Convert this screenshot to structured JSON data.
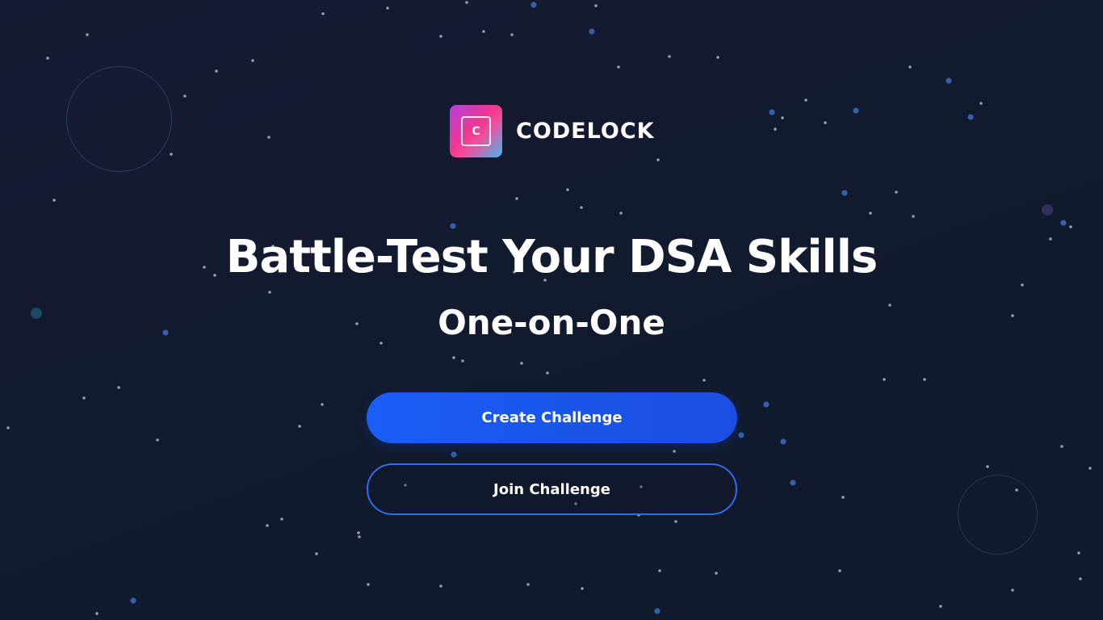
{
  "brand": {
    "logo_letter": "C",
    "name": "CODELOCK"
  },
  "hero": {
    "headline": "Battle-Test Your DSA Skills",
    "subheadline": "One-on-One"
  },
  "actions": {
    "create_label": "Create Challenge",
    "join_label": "Join Challenge"
  },
  "colors": {
    "background": "#131a2e",
    "primary_button": "#1a5ef5",
    "outline_button_border": "#2f6cf0",
    "logo_gradient_start": "#b13fe0",
    "logo_gradient_mid": "#f0378f",
    "logo_gradient_end": "#3fb8f0",
    "text": "#ffffff"
  }
}
